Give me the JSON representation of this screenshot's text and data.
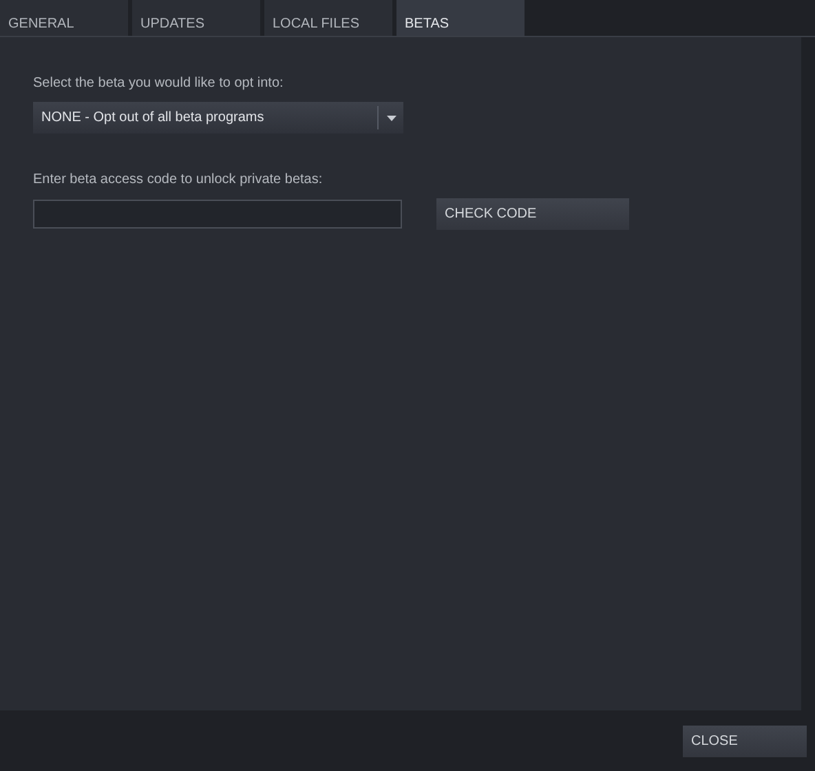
{
  "tabs": [
    {
      "label": "GENERAL",
      "selected": false
    },
    {
      "label": "UPDATES",
      "selected": false
    },
    {
      "label": "LOCAL FILES",
      "selected": false
    },
    {
      "label": "BETAS",
      "selected": true
    }
  ],
  "beta_select": {
    "label": "Select the beta you would like to opt into:",
    "value": "NONE - Opt out of all beta programs"
  },
  "access_code": {
    "label": "Enter beta access code to unlock private betas:",
    "button": "CHECK CODE"
  },
  "footer": {
    "button": "CLOSE"
  }
}
